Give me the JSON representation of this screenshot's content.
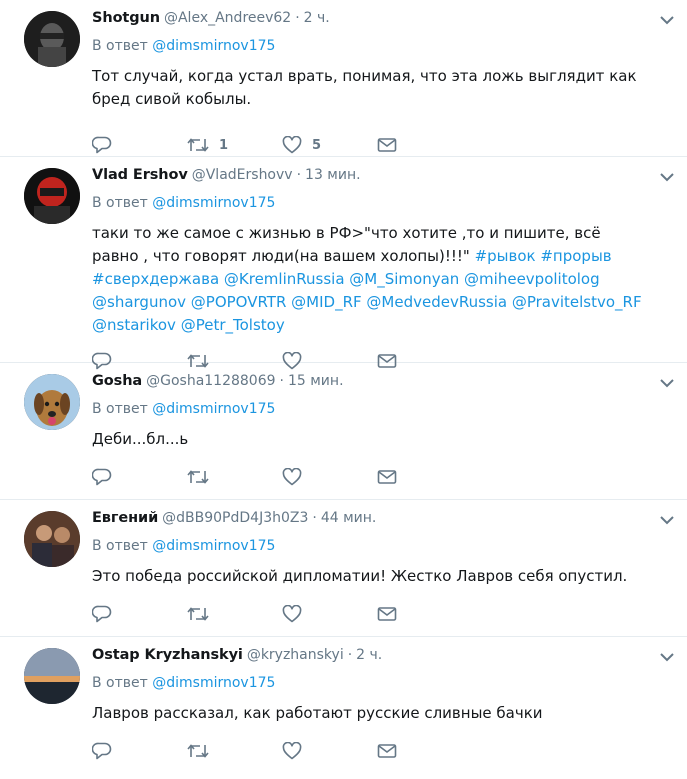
{
  "reply_prefix": "В ответ",
  "tweets": [
    {
      "name": "Shotgun",
      "handle": "@Alex_Andreev62",
      "dot": "·",
      "time": "2 ч.",
      "mention": "@dimsmirnov175",
      "text": "Тот случай, когда устал врать, понимая, что эта ложь выглядит как бред сивой кобылы.",
      "retweets": "1",
      "likes": "5",
      "avatar_color": "#3a3a3a"
    },
    {
      "name": "Vlad Ershov",
      "handle": "@VladErshovv",
      "dot": "·",
      "time": "13 мин.",
      "mention": "@dimsmirnov175",
      "text": "таки то же самое с  жизнью в РФ>\"что хотите ,то и пишите, всё равно , что говорят люди(на вашем холопы)!!!\" ",
      "links": "#рывок #прорыв #сверхдержава @KremlinRussia @M_Simonyan @miheevpolitolog @shargunov @POPOVRTR @MID_RF @MedvedevRussia @Pravitelstvo_RF @nstarikov @Petr_Tolstoy",
      "retweets": "",
      "likes": "",
      "avatar_color": "#b0201c"
    },
    {
      "name": "Gosha",
      "handle": "@Gosha11288069",
      "dot": "·",
      "time": "15 мин.",
      "mention": "@dimsmirnov175",
      "text": "Деби...бл...ь",
      "retweets": "",
      "likes": "",
      "avatar_color": "#a8c8e8"
    },
    {
      "name": "Евгений",
      "handle": "@dBB90PdD4J3h0Z3",
      "dot": "·",
      "time": "44 мин.",
      "mention": "@dimsmirnov175",
      "text": "Это победа российской дипломатии! Жестко Лавров себя опустил.",
      "retweets": "",
      "likes": "",
      "avatar_color": "#6b4a3a"
    },
    {
      "name": "Ostap Kryzhanskyi",
      "handle": "@kryzhanskyi",
      "dot": "·",
      "time": "2 ч.",
      "mention": "@dimsmirnov175",
      "text": "Лавров рассказал, как работают русские сливные бачки",
      "retweets": "",
      "likes": "",
      "avatar_color": "#2e3440"
    }
  ],
  "icons": {
    "reply": "reply-icon",
    "retweet": "retweet-icon",
    "like": "heart-icon",
    "dm": "envelope-icon",
    "caret": "chevron-down-icon"
  },
  "colors": {
    "link": "#1b95e0",
    "secondary": "#657786",
    "icon": "#657786",
    "divider": "#e6ecf0"
  }
}
